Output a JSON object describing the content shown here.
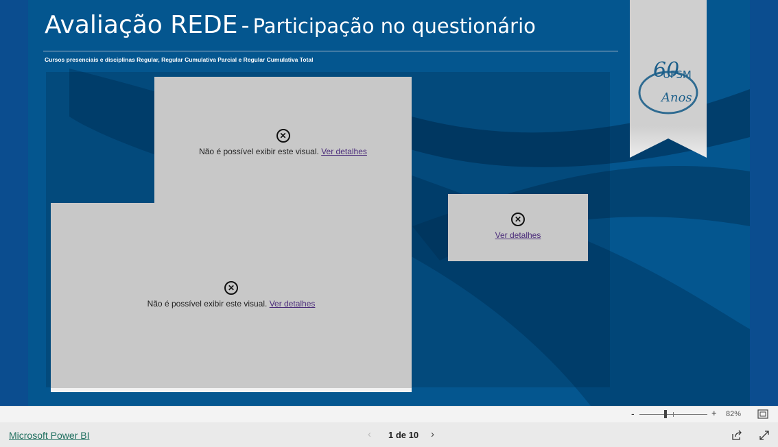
{
  "report": {
    "title_main": "Avaliação REDE",
    "title_separator": "-",
    "title_sub": "Participação no questionário",
    "subtitle": "Cursos presenciais e disciplinas Regular, Regular Cumulativa Parcial e Regular Cumulativa Total",
    "logo": {
      "brand": "UFSM",
      "years": "60",
      "word": "Anos"
    }
  },
  "visuals": [
    {
      "error_icon": "close-circle-icon",
      "message": "Não é possível exibir este visual.",
      "link": "Ver detalhes"
    },
    {
      "error_icon": "close-circle-icon",
      "message": "Não é possível exibir este visual.",
      "link": "Ver detalhes"
    },
    {
      "error_icon": "close-circle-icon",
      "message": "",
      "link": "Ver detalhes"
    }
  ],
  "zoom": {
    "minus": "-",
    "plus": "+",
    "value": "82%",
    "level": 0.82
  },
  "footer": {
    "brand": "Microsoft Power BI",
    "page_indicator": "1 de 10",
    "prev": "‹",
    "next": "›"
  },
  "colors": {
    "background": "#04568f",
    "visual_error_bg": "#c8c8c8",
    "link": "#4b2c7a",
    "ribbon": "#cfcfcf",
    "logo": "#1d5f8a"
  }
}
